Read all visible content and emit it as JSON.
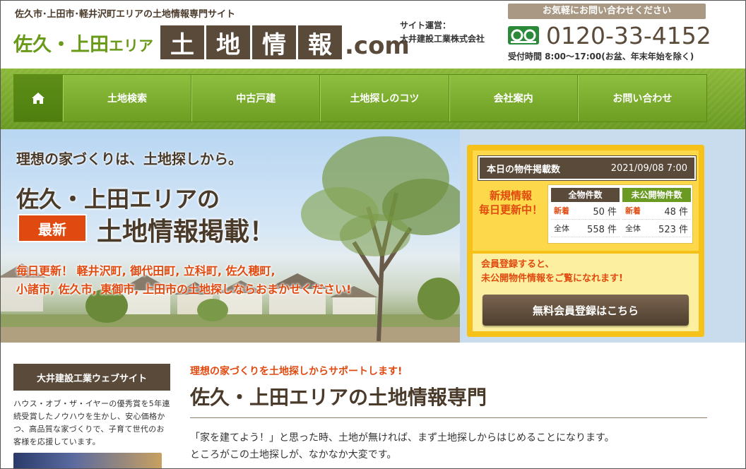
{
  "header": {
    "tagline": "佐久市･上田市･軽井沢町エリアの土地情報専門サイト",
    "logo_area": "佐久・上田",
    "logo_area_suffix": "エリア",
    "logo_blocks": [
      "土",
      "地",
      "情",
      "報"
    ],
    "logo_dotcom": ".com",
    "operator_label": "サイト運営：",
    "operator_name": "大井建設工業株式会社",
    "contact_banner": "お気軽にお問い合わせください",
    "phone": "0120-33-4152",
    "hours": "受付時間 8:00～17:00(お盆、年末年始を除く)"
  },
  "nav": {
    "items": [
      {
        "label": "土地検索"
      },
      {
        "label": "中古戸建"
      },
      {
        "label": "土地探しのコツ"
      },
      {
        "label": "会社案内"
      },
      {
        "label": "お問い合わせ"
      }
    ]
  },
  "hero": {
    "line1": "理想の家づくりは、土地探しから。",
    "line2": "佐久・上田エリアの",
    "badge": "最新",
    "line3": "土地情報掲載！",
    "line4a": "毎日更新！ 軽井沢町, 御代田町, 立科町, 佐久穂町,",
    "line4b": "小諸市, 佐久市, 東御市, 上田市の土地探しならおまかせください!"
  },
  "info": {
    "header_label": "本日の物件掲載数",
    "date": "2021/09/08 7:00",
    "new_info_1": "新規情報",
    "new_info_2": "毎日更新中！",
    "all": {
      "head": "全物件数",
      "new_label": "新着",
      "new_value": "50 件",
      "total_label": "全体",
      "total_value": "558 件"
    },
    "unpub": {
      "head": "未公開物件数",
      "new_label": "新着",
      "new_value": "48 件",
      "total_label": "全体",
      "total_value": "523 件"
    },
    "member_msg_1": "会員登録すると、",
    "member_msg_2": "未公開物件情報をご覧になれます!",
    "register_button": "無料会員登録はこちら"
  },
  "sidebar": {
    "title": "大井建設工業ウェブサイト",
    "text": "ハウス・オブ・ザ・イヤーの優秀賞を5年連続受賞したノウハウを生かし、安心価格かつ、高品質な家づくりで、子育て世代のお客様を応援しています。"
  },
  "main": {
    "subtitle": "理想の家づくりを土地探しからサポートします!",
    "title": "佐久・上田エリアの土地情報専門",
    "body1": "「家を建てよう！」と思った時、土地が無ければ、まず土地探しからはじめることになります。",
    "body2": "ところがこの土地探しが、なかなか大変です。"
  },
  "colors": {
    "brown": "#5a4a3a",
    "green": "#6a9a22",
    "orange": "#e04a10",
    "yellow": "#f6c21a"
  }
}
